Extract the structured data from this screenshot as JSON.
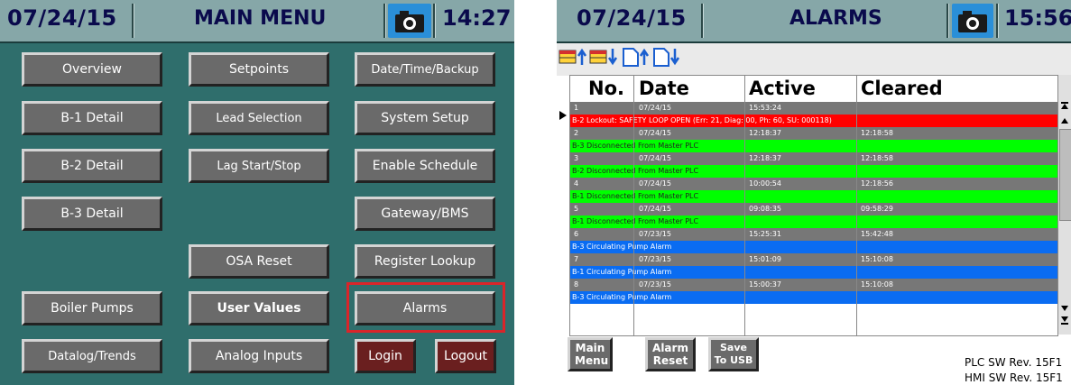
{
  "main_menu": {
    "header": {
      "date": "07/24/15",
      "title": "MAIN MENU",
      "time": "14:27"
    },
    "buttons": {
      "overview": "Overview",
      "setpoints": "Setpoints",
      "date_time_backup": "Date/Time/Backup",
      "b1_detail": "B-1 Detail",
      "lead_selection": "Lead Selection",
      "system_setup": "System Setup",
      "b2_detail": "B-2 Detail",
      "lag_start_stop": "Lag Start/Stop",
      "enable_schedule": "Enable Schedule",
      "b3_detail": "B-3 Detail",
      "gateway_bms": "Gateway/BMS",
      "osa_reset": "OSA Reset",
      "register_lookup": "Register Lookup",
      "boiler_pumps": "Boiler Pumps",
      "user_values": "User Values",
      "alarms": "Alarms",
      "datalog_trends": "Datalog/Trends",
      "analog_inputs": "Analog Inputs",
      "login": "Login",
      "logout": "Logout"
    }
  },
  "alarms_screen": {
    "header": {
      "date": "07/24/15",
      "title": "ALARMS",
      "time": "15:56"
    },
    "columns": [
      "No.",
      "Date",
      "Active",
      "Cleared"
    ],
    "alarms": [
      {
        "no": "1",
        "date": "07/24/15",
        "active": "15:53:24",
        "cleared": "",
        "message": "B-2 Lockout: SAFETY LOOP OPEN (Err: 21, Diag: 00, Ph: 60, SU: 000118)",
        "color": "#ff0000"
      },
      {
        "no": "2",
        "date": "07/24/15",
        "active": "12:18:37",
        "cleared": "12:18:58",
        "message": "B-3 Disconnected From Master PLC",
        "color": "#00ff00"
      },
      {
        "no": "3",
        "date": "07/24/15",
        "active": "12:18:37",
        "cleared": "12:18:58",
        "message": "B-2 Disconnected From Master PLC",
        "color": "#00ff00"
      },
      {
        "no": "4",
        "date": "07/24/15",
        "active": "10:00:54",
        "cleared": "12:18:56",
        "message": "B-1 Disconnected From Master PLC",
        "color": "#00ff00"
      },
      {
        "no": "5",
        "date": "07/24/15",
        "active": "09:08:35",
        "cleared": "09:58:29",
        "message": "B-1 Disconnected From Master PLC",
        "color": "#00ff00"
      },
      {
        "no": "6",
        "date": "07/23/15",
        "active": "15:25:31",
        "cleared": "15:42:48",
        "message": "B-3 Circulating Pump Alarm",
        "color": "#0a6cf2"
      },
      {
        "no": "7",
        "date": "07/23/15",
        "active": "15:01:09",
        "cleared": "15:10:08",
        "message": "B-1 Circulating Pump Alarm",
        "color": "#0a6cf2"
      },
      {
        "no": "8",
        "date": "07/23/15",
        "active": "15:00:37",
        "cleared": "15:10:08",
        "message": "B-3 Circulating Pump Alarm",
        "color": "#0a6cf2"
      }
    ],
    "buttons": {
      "main_menu": "Main Menu",
      "alarm_reset": "Alarm Reset",
      "save_to_usb": "Save To USB"
    },
    "plc_rev": "PLC SW Rev. 15F1",
    "hmi_rev": "HMI SW Rev. 15F1",
    "icons": [
      "sort-up-icon",
      "sort-down-icon",
      "page-up-icon",
      "page-down-icon",
      "camera-icon"
    ]
  }
}
